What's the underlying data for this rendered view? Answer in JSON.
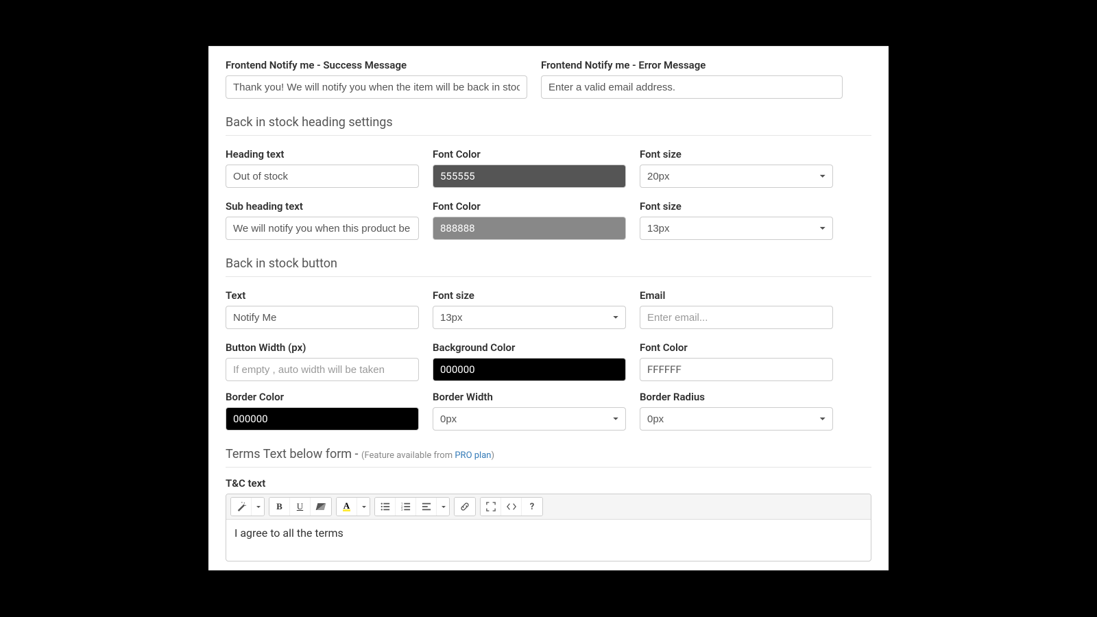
{
  "notify": {
    "success_label": "Frontend Notify me - Success Message",
    "success_value": "Thank you! We will notify you when the item will be back in stoc",
    "error_label": "Frontend Notify me - Error Message",
    "error_value": "Enter a valid email address."
  },
  "heading_section": {
    "title": "Back in stock heading settings",
    "heading_text_label": "Heading text",
    "heading_text_value": "Out of stock",
    "heading_font_color_label": "Font Color",
    "heading_font_color_value": "555555",
    "heading_font_size_label": "Font size",
    "heading_font_size_value": "20px",
    "sub_heading_label": "Sub heading text",
    "sub_heading_value": "We will notify you when this product be",
    "sub_font_color_label": "Font Color",
    "sub_font_color_value": "888888",
    "sub_font_size_label": "Font size",
    "sub_font_size_value": "13px"
  },
  "button_section": {
    "title": "Back in stock button",
    "text_label": "Text",
    "text_value": "Notify Me",
    "font_size_label": "Font size",
    "font_size_value": "13px",
    "email_label": "Email",
    "email_placeholder": "Enter email...",
    "width_label": "Button Width (px)",
    "width_placeholder": "If empty , auto width will be taken",
    "bg_color_label": "Background Color",
    "bg_color_value": "000000",
    "font_color_label": "Font Color",
    "font_color_value": "FFFFFF",
    "border_color_label": "Border Color",
    "border_color_value": "000000",
    "border_width_label": "Border Width",
    "border_width_value": "0px",
    "border_radius_label": "Border Radius",
    "border_radius_value": "0px"
  },
  "terms_section": {
    "title_prefix": "Terms Text below form - ",
    "note_prefix": "(Feature available from ",
    "note_link": "PRO plan",
    "note_suffix": ")",
    "tc_label": "T&C text",
    "tc_value": "I agree to all the terms"
  }
}
